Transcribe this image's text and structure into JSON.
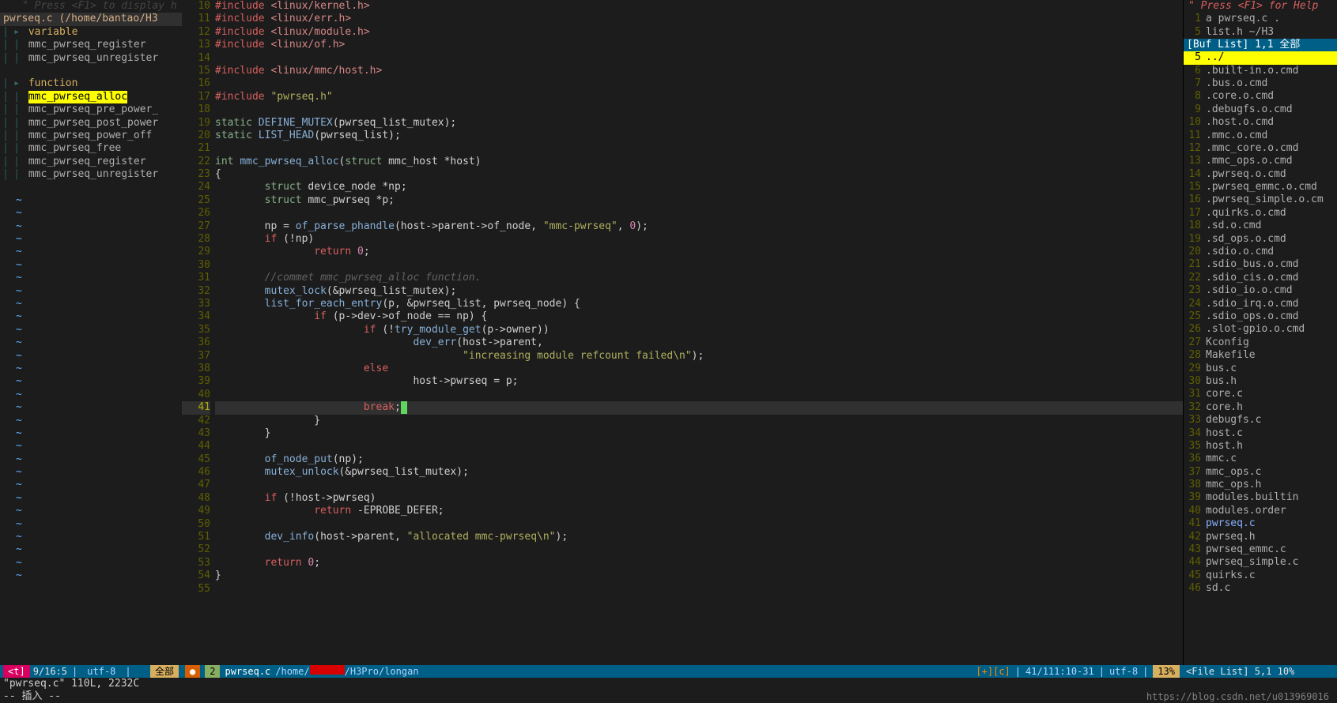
{
  "tagbar": {
    "hint": "\" Press <F1> to display h",
    "header": "pwrseq.c (/home/bantao/H3",
    "groups": [
      {
        "label": "variable",
        "items": [
          "mmc_pwrseq_register",
          "mmc_pwrseq_unregister"
        ]
      },
      {
        "label": "function",
        "items": [
          "mmc_pwrseq_alloc",
          "mmc_pwrseq_pre_power_",
          "mmc_pwrseq_post_power",
          "mmc_pwrseq_power_off",
          "mmc_pwrseq_free",
          "mmc_pwrseq_register",
          "mmc_pwrseq_unregister"
        ]
      }
    ],
    "selected": "mmc_pwrseq_alloc"
  },
  "editor": {
    "filename": "pwrseq.c",
    "path_prefix": "/home/",
    "path_redacted": "bantao",
    "path_suffix": "/H3Pro/longan",
    "first_line_no": 10,
    "current_line_no": 41,
    "lines": [
      {
        "n": 10,
        "seg": [
          [
            "kw-pp",
            "#include "
          ],
          [
            "kw-inc",
            "<linux/kernel.h>"
          ]
        ]
      },
      {
        "n": 11,
        "seg": [
          [
            "kw-pp",
            "#include "
          ],
          [
            "kw-inc",
            "<linux/err.h>"
          ]
        ]
      },
      {
        "n": 12,
        "seg": [
          [
            "kw-pp",
            "#include "
          ],
          [
            "kw-inc",
            "<linux/module.h>"
          ]
        ]
      },
      {
        "n": 13,
        "seg": [
          [
            "kw-pp",
            "#include "
          ],
          [
            "kw-inc",
            "<linux/of.h>"
          ]
        ]
      },
      {
        "n": 14,
        "seg": []
      },
      {
        "n": 15,
        "seg": [
          [
            "kw-pp",
            "#include "
          ],
          [
            "kw-inc",
            "<linux/mmc/host.h>"
          ]
        ]
      },
      {
        "n": 16,
        "seg": []
      },
      {
        "n": 17,
        "seg": [
          [
            "kw-pp",
            "#include "
          ],
          [
            "str",
            "\"pwrseq.h\""
          ]
        ]
      },
      {
        "n": 18,
        "seg": []
      },
      {
        "n": 19,
        "seg": [
          [
            "kw-storage",
            "static"
          ],
          [
            "ident",
            " "
          ],
          [
            "fn",
            "DEFINE_MUTEX"
          ],
          [
            "op",
            "(pwrseq_list_mutex);"
          ]
        ]
      },
      {
        "n": 20,
        "seg": [
          [
            "kw-storage",
            "static"
          ],
          [
            "ident",
            " "
          ],
          [
            "fn",
            "LIST_HEAD"
          ],
          [
            "op",
            "(pwrseq_list);"
          ]
        ]
      },
      {
        "n": 21,
        "seg": []
      },
      {
        "n": 22,
        "seg": [
          [
            "kw-type",
            "int"
          ],
          [
            "ident",
            " "
          ],
          [
            "fn",
            "mmc_pwrseq_alloc"
          ],
          [
            "op",
            "("
          ],
          [
            "kw-type",
            "struct"
          ],
          [
            "ident",
            " mmc_host *host)"
          ]
        ]
      },
      {
        "n": 23,
        "seg": [
          [
            "op",
            "{"
          ]
        ]
      },
      {
        "n": 24,
        "seg": [
          [
            "ident",
            "        "
          ],
          [
            "kw-type",
            "struct"
          ],
          [
            "ident",
            " device_node *np;"
          ]
        ]
      },
      {
        "n": 25,
        "seg": [
          [
            "ident",
            "        "
          ],
          [
            "kw-type",
            "struct"
          ],
          [
            "ident",
            " mmc_pwrseq *p;"
          ]
        ]
      },
      {
        "n": 26,
        "seg": []
      },
      {
        "n": 27,
        "seg": [
          [
            "ident",
            "        np = "
          ],
          [
            "fn",
            "of_parse_phandle"
          ],
          [
            "op",
            "(host->parent->of_node, "
          ],
          [
            "str",
            "\"mmc-pwrseq\""
          ],
          [
            "op",
            ", "
          ],
          [
            "num",
            "0"
          ],
          [
            "op",
            ");"
          ]
        ]
      },
      {
        "n": 28,
        "seg": [
          [
            "ident",
            "        "
          ],
          [
            "kw-flow",
            "if"
          ],
          [
            "op",
            " (!np)"
          ]
        ]
      },
      {
        "n": 29,
        "seg": [
          [
            "ident",
            "                "
          ],
          [
            "kw-flow",
            "return"
          ],
          [
            "op",
            " "
          ],
          [
            "num",
            "0"
          ],
          [
            "op",
            ";"
          ]
        ]
      },
      {
        "n": 30,
        "seg": []
      },
      {
        "n": 31,
        "seg": [
          [
            "ident",
            "        "
          ],
          [
            "cmt",
            "//commet mmc_pwrseq_alloc function."
          ]
        ]
      },
      {
        "n": 32,
        "seg": [
          [
            "ident",
            "        "
          ],
          [
            "fn",
            "mutex_lock"
          ],
          [
            "op",
            "(&pwrseq_list_mutex);"
          ]
        ]
      },
      {
        "n": 33,
        "seg": [
          [
            "ident",
            "        "
          ],
          [
            "fn",
            "list_for_each_entry"
          ],
          [
            "op",
            "(p, &pwrseq_list, pwrseq_node) {"
          ]
        ]
      },
      {
        "n": 34,
        "seg": [
          [
            "ident",
            "                "
          ],
          [
            "kw-flow",
            "if"
          ],
          [
            "op",
            " (p->dev->of_node == np) {"
          ]
        ]
      },
      {
        "n": 35,
        "seg": [
          [
            "ident",
            "                        "
          ],
          [
            "kw-flow",
            "if"
          ],
          [
            "op",
            " (!"
          ],
          [
            "fn",
            "try_module_get"
          ],
          [
            "op",
            "(p->owner))"
          ]
        ]
      },
      {
        "n": 36,
        "seg": [
          [
            "ident",
            "                                "
          ],
          [
            "fn",
            "dev_err"
          ],
          [
            "op",
            "(host->parent,"
          ]
        ]
      },
      {
        "n": 37,
        "seg": [
          [
            "ident",
            "                                        "
          ],
          [
            "str",
            "\"increasing module refcount failed\\n\""
          ],
          [
            "op",
            ");"
          ]
        ]
      },
      {
        "n": 38,
        "seg": [
          [
            "ident",
            "                        "
          ],
          [
            "kw-flow",
            "else"
          ]
        ]
      },
      {
        "n": 39,
        "seg": [
          [
            "ident",
            "                                host->pwrseq = p;"
          ]
        ]
      },
      {
        "n": 40,
        "seg": []
      },
      {
        "n": 41,
        "seg": [
          [
            "ident",
            "                        "
          ],
          [
            "kw-flow",
            "break"
          ],
          [
            "op",
            ";"
          ]
        ],
        "cursor": true
      },
      {
        "n": 42,
        "seg": [
          [
            "ident",
            "                }"
          ]
        ]
      },
      {
        "n": 43,
        "seg": [
          [
            "ident",
            "        }"
          ]
        ]
      },
      {
        "n": 44,
        "seg": []
      },
      {
        "n": 45,
        "seg": [
          [
            "ident",
            "        "
          ],
          [
            "fn",
            "of_node_put"
          ],
          [
            "op",
            "(np);"
          ]
        ]
      },
      {
        "n": 46,
        "seg": [
          [
            "ident",
            "        "
          ],
          [
            "fn",
            "mutex_unlock"
          ],
          [
            "op",
            "(&pwrseq_list_mutex);"
          ]
        ]
      },
      {
        "n": 47,
        "seg": []
      },
      {
        "n": 48,
        "seg": [
          [
            "ident",
            "        "
          ],
          [
            "kw-flow",
            "if"
          ],
          [
            "op",
            " (!host->pwrseq)"
          ]
        ]
      },
      {
        "n": 49,
        "seg": [
          [
            "ident",
            "                "
          ],
          [
            "kw-flow",
            "return"
          ],
          [
            "op",
            " -EPROBE_DEFER;"
          ]
        ]
      },
      {
        "n": 50,
        "seg": []
      },
      {
        "n": 51,
        "seg": [
          [
            "ident",
            "        "
          ],
          [
            "fn",
            "dev_info"
          ],
          [
            "op",
            "(host->parent, "
          ],
          [
            "str",
            "\"allocated mmc-pwrseq\\n\""
          ],
          [
            "op",
            ");"
          ]
        ]
      },
      {
        "n": 52,
        "seg": []
      },
      {
        "n": 53,
        "seg": [
          [
            "ident",
            "        "
          ],
          [
            "kw-flow",
            "return"
          ],
          [
            "op",
            " "
          ],
          [
            "num",
            "0"
          ],
          [
            "op",
            ";"
          ]
        ]
      },
      {
        "n": 54,
        "seg": [
          [
            "op",
            "}"
          ]
        ]
      },
      {
        "n": 55,
        "seg": []
      }
    ]
  },
  "filelist": {
    "hint": "\" Press <F1> for Help",
    "header_rows": [
      {
        "n": 1,
        "label": "a     pwrseq.c ."
      },
      {
        "n": 5,
        "label": "      list.h  ~/H3"
      }
    ],
    "buf_status": "[Buf List]  1,1   全部",
    "selected_index": 0,
    "items": [
      {
        "n": 5,
        "label": "../"
      },
      {
        "n": 6,
        "label": ".built-in.o.cmd"
      },
      {
        "n": 7,
        "label": ".bus.o.cmd"
      },
      {
        "n": 8,
        "label": ".core.o.cmd"
      },
      {
        "n": 9,
        "label": ".debugfs.o.cmd"
      },
      {
        "n": 10,
        "label": ".host.o.cmd"
      },
      {
        "n": 11,
        "label": ".mmc.o.cmd"
      },
      {
        "n": 12,
        "label": ".mmc_core.o.cmd"
      },
      {
        "n": 13,
        "label": ".mmc_ops.o.cmd"
      },
      {
        "n": 14,
        "label": ".pwrseq.o.cmd"
      },
      {
        "n": 15,
        "label": ".pwrseq_emmc.o.cmd"
      },
      {
        "n": 16,
        "label": ".pwrseq_simple.o.cm"
      },
      {
        "n": 17,
        "label": ".quirks.o.cmd"
      },
      {
        "n": 18,
        "label": ".sd.o.cmd"
      },
      {
        "n": 19,
        "label": ".sd_ops.o.cmd"
      },
      {
        "n": 20,
        "label": ".sdio.o.cmd"
      },
      {
        "n": 21,
        "label": ".sdio_bus.o.cmd"
      },
      {
        "n": 22,
        "label": ".sdio_cis.o.cmd"
      },
      {
        "n": 23,
        "label": ".sdio_io.o.cmd"
      },
      {
        "n": 24,
        "label": ".sdio_irq.o.cmd"
      },
      {
        "n": 25,
        "label": ".sdio_ops.o.cmd"
      },
      {
        "n": 26,
        "label": ".slot-gpio.o.cmd"
      },
      {
        "n": 27,
        "label": "Kconfig"
      },
      {
        "n": 28,
        "label": "Makefile"
      },
      {
        "n": 29,
        "label": "bus.c"
      },
      {
        "n": 30,
        "label": "bus.h"
      },
      {
        "n": 31,
        "label": "core.c"
      },
      {
        "n": 32,
        "label": "core.h"
      },
      {
        "n": 33,
        "label": "debugfs.c"
      },
      {
        "n": 34,
        "label": "host.c"
      },
      {
        "n": 35,
        "label": "host.h"
      },
      {
        "n": 36,
        "label": "mmc.c"
      },
      {
        "n": 37,
        "label": "mmc_ops.c"
      },
      {
        "n": 38,
        "label": "mmc_ops.h"
      },
      {
        "n": 39,
        "label": "modules.builtin"
      },
      {
        "n": 40,
        "label": "modules.order"
      },
      {
        "n": 41,
        "label": "pwrseq.c"
      },
      {
        "n": 42,
        "label": "pwrseq.h"
      },
      {
        "n": 43,
        "label": "pwrseq_emmc.c"
      },
      {
        "n": 44,
        "label": "pwrseq_simple.c"
      },
      {
        "n": 45,
        "label": "quirks.c"
      },
      {
        "n": 46,
        "label": "sd.c"
      }
    ],
    "status": "<File List] 5,1     10%"
  },
  "status": {
    "left": {
      "badge": "<t]",
      "pos": "9/16:5",
      "enc": "utf-8",
      "sep": "|",
      "all": "全部"
    },
    "mid": {
      "modebadge": "●",
      "num": "2",
      "fname": "pwrseq.c",
      "flags": "[+][c]",
      "pos": "41/111:10-31",
      "enc": "utf-8",
      "pct": "13%"
    }
  },
  "bottom": {
    "msg": "\"pwrseq.c\" 110L, 2232C",
    "mode": "-- 插入 --",
    "watermark": "https://blog.csdn.net/u013969016"
  }
}
